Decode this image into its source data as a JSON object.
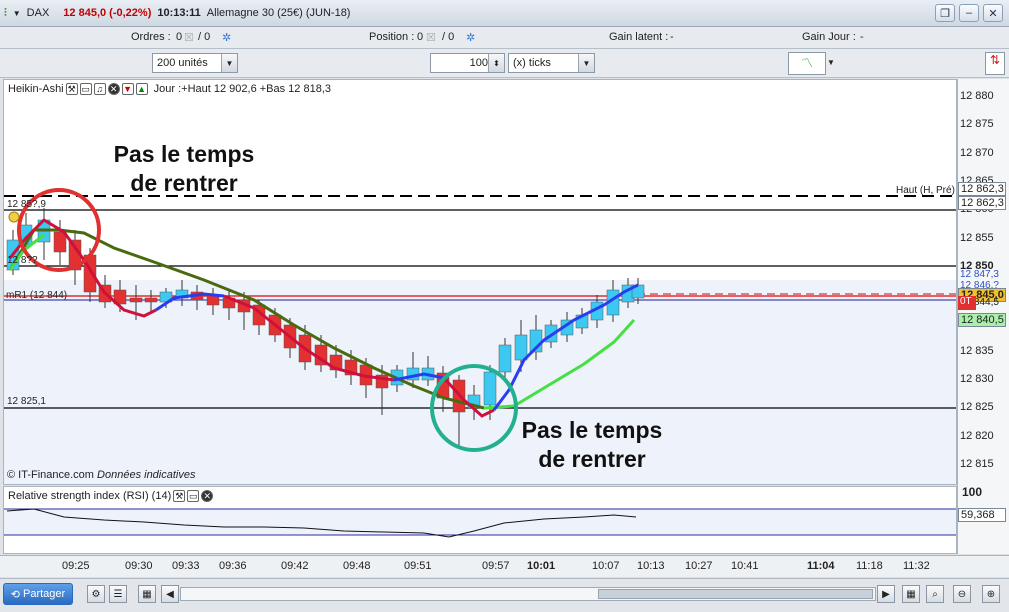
{
  "titlebar": {
    "symbol": "DAX",
    "price": "12 845,0 (-0,22%)",
    "time": "10:13:11",
    "instrument": "Allemagne 30 (25€) (JUN-18)"
  },
  "infobar": {
    "orders_label": "Ordres :",
    "orders_value": "0",
    "orders_value2": "/ 0",
    "position_label": "Position :",
    "position_value": "0",
    "position_value2": "/ 0",
    "gain_latent_label": "Gain latent :",
    "gain_latent_value": "-",
    "gain_jour_label": "Gain Jour :",
    "gain_jour_value": "-"
  },
  "toolbar": {
    "units_select": "200 unités",
    "quantity": "100",
    "ticks_select": "(x) ticks"
  },
  "chart": {
    "indicator_name": "Heikin-Ashi",
    "daily_info": "Jour :+Haut 12 902,6 +Bas 12 818,3",
    "copyright": "© IT-Finance.com",
    "data_note": "Données indicatives",
    "line_labels": {
      "top_left": "12 85?,9",
      "mid_left": "12 8??",
      "mr1": "mR1 (12 844)",
      "bottom_left": "12 825,1",
      "haut_label": "Haut (H, Pré)"
    },
    "annotations": [
      {
        "line1": "Pas le temps",
        "line2": "de rentrer"
      },
      {
        "line1": "Pas le temps",
        "line2": "de rentrer"
      }
    ],
    "colors": {
      "bull": "#3cc8f0",
      "bear": "#e33030",
      "ma_fast_bull": "#2a3cf0",
      "ma_fast_bear": "#d0103c",
      "ma_slow_bull": "#44e044",
      "ma_slow_bear": "#4a6a10",
      "circle_red": "#e03030",
      "circle_teal": "#22b090"
    }
  },
  "yaxis": {
    "labels": [
      "12 880",
      "12 875",
      "12 870",
      "12 865",
      "12 860",
      "12 855",
      "12 850",
      "12 845",
      "12 840",
      "12 835",
      "12 830",
      "12 825",
      "12 820",
      "12 815"
    ],
    "tags": {
      "haut1": "12 862,3",
      "haut2": "12 862,3",
      "t1": "12 847,3",
      "t2": "12 846,?",
      "current": "12 845,0",
      "t3": "12 844,5",
      "ot": "0T",
      "ma": "12 840,5"
    }
  },
  "rsi": {
    "title": "Relative strength index (RSI) (14)",
    "value": "59,368",
    "level": "100"
  },
  "xaxis": {
    "labels": [
      "09:25",
      "09:30",
      "09:33",
      "09:36",
      "09:42",
      "09:48",
      "09:51",
      "09:57",
      "10:01",
      "10:07",
      "10:13",
      "10:27",
      "10:41",
      "11:04",
      "11:18",
      "11:32"
    ]
  },
  "bottombar": {
    "share_label": "Partager"
  }
}
